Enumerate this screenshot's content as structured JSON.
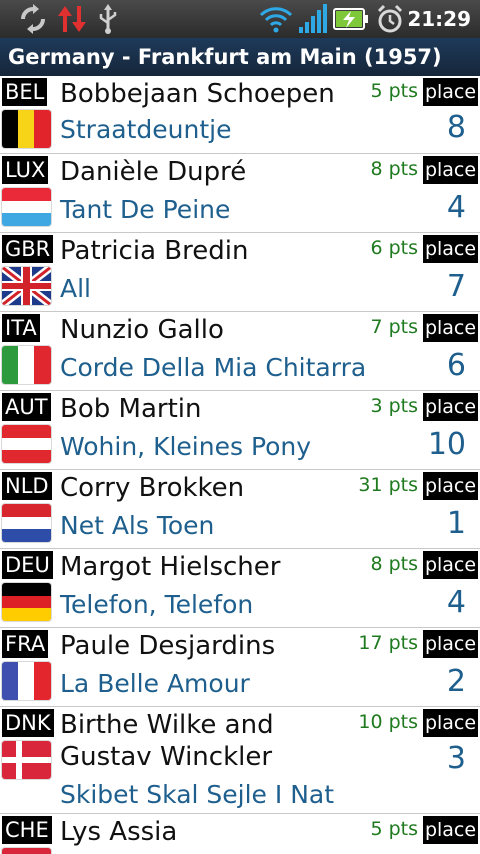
{
  "status_bar": {
    "time": "21:29",
    "icons": [
      "sync-icon",
      "data-transfer-icon",
      "usb-icon",
      "wifi-icon",
      "signal-icon",
      "battery-charging-icon",
      "alarm-icon"
    ]
  },
  "title": "Germany - Frankfurt am Main (1957)",
  "colors": {
    "artist": "#111111",
    "song": "#1e5f8e",
    "points": "#1f7a1f",
    "place_value": "#1e5f8e"
  },
  "place_label": "place",
  "entries": [
    {
      "code": "BEL",
      "artist": "Bobbejaan Schoepen",
      "song": "Straatdeuntje",
      "points": "5 pts",
      "place": "8",
      "flag": "belgium"
    },
    {
      "code": "LUX",
      "artist": "Danièle Dupré",
      "song": "Tant De Peine",
      "points": "8 pts",
      "place": "4",
      "flag": "luxembourg"
    },
    {
      "code": "GBR",
      "artist": "Patricia Bredin",
      "song": "All",
      "points": "6 pts",
      "place": "7",
      "flag": "united-kingdom"
    },
    {
      "code": "ITA",
      "artist": "Nunzio Gallo",
      "song": "Corde Della Mia Chitarra",
      "points": "7 pts",
      "place": "6",
      "flag": "italy"
    },
    {
      "code": "AUT",
      "artist": "Bob Martin",
      "song": "Wohin, Kleines Pony",
      "points": "3 pts",
      "place": "10",
      "flag": "austria"
    },
    {
      "code": "NLD",
      "artist": "Corry Brokken",
      "song": "Net Als Toen",
      "points": "31 pts",
      "place": "1",
      "flag": "netherlands"
    },
    {
      "code": "DEU",
      "artist": "Margot Hielscher",
      "song": "Telefon, Telefon",
      "points": "8 pts",
      "place": "4",
      "flag": "germany"
    },
    {
      "code": "FRA",
      "artist": "Paule Desjardins",
      "song": "La Belle Amour",
      "points": "17 pts",
      "place": "2",
      "flag": "france"
    },
    {
      "code": "DNK",
      "artist_line1": "Birthe Wilke and",
      "artist_line2": "Gustav Winckler",
      "song": "Skibet Skal Sejle I Nat",
      "points": "10 pts",
      "place": "3",
      "flag": "denmark"
    },
    {
      "code": "CHE",
      "artist": "Lys Assia",
      "song": "",
      "points": "5 pts",
      "place": "",
      "flag": "switzerland"
    }
  ]
}
